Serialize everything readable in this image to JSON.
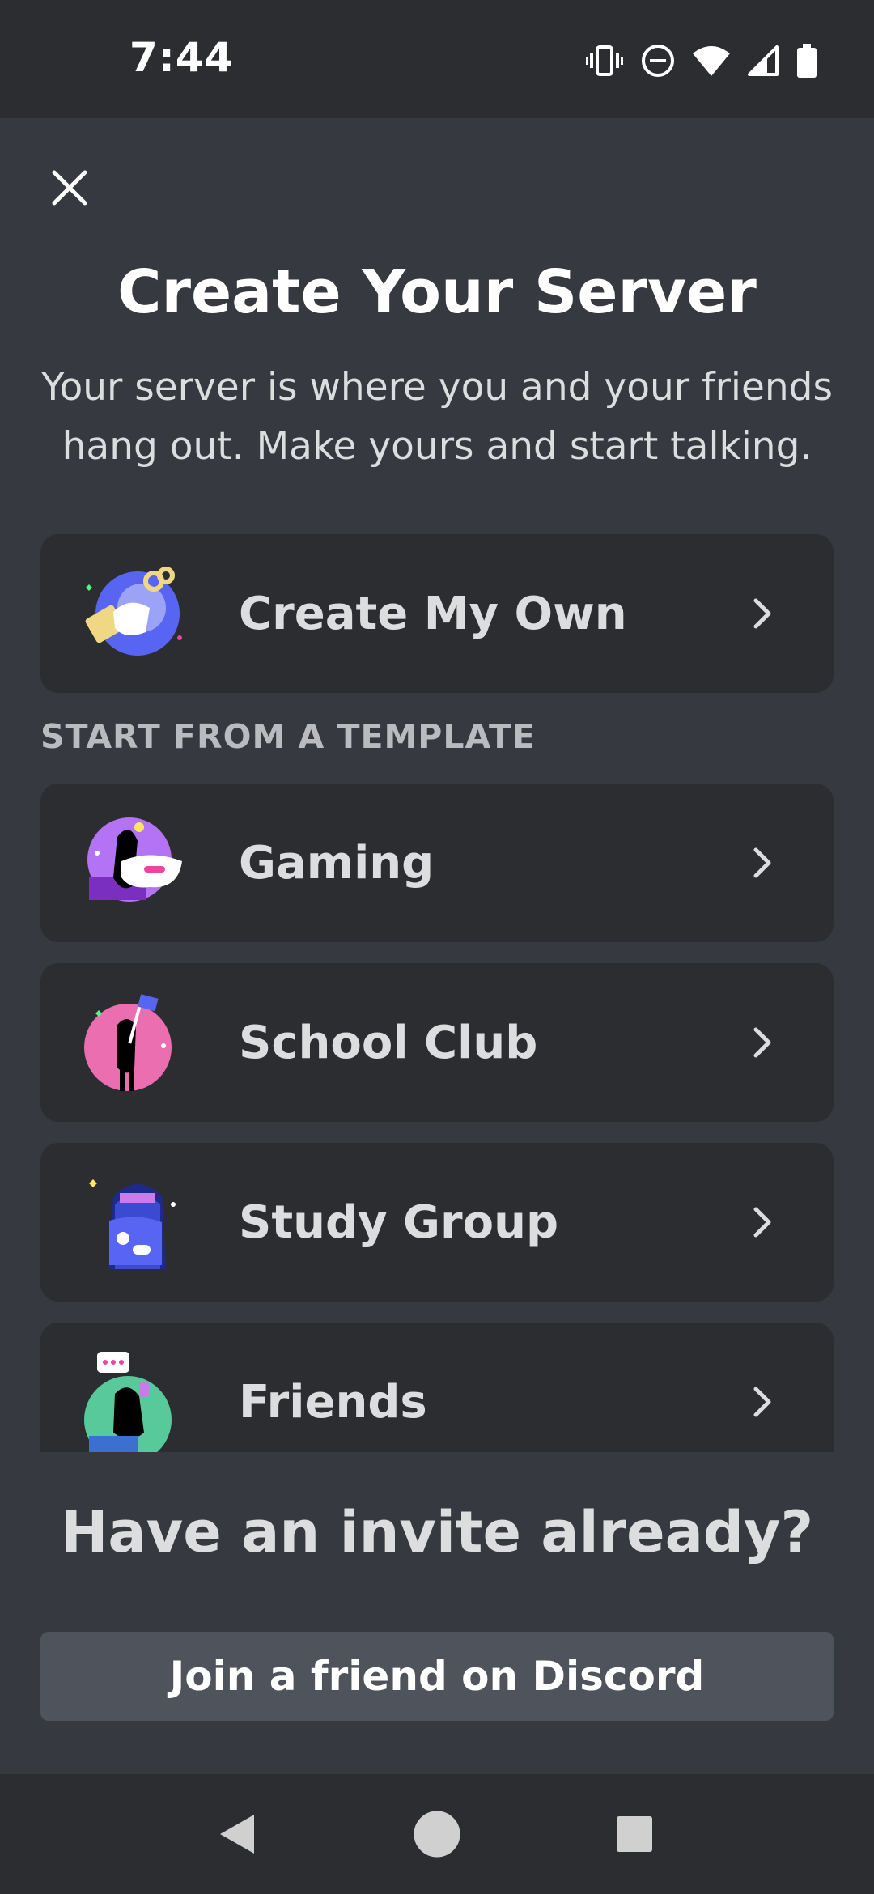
{
  "status_bar": {
    "time": "7:44",
    "icons": [
      "vibrate-icon",
      "do-not-disturb-icon",
      "wifi-icon",
      "cellular-signal-icon",
      "battery-icon"
    ]
  },
  "header": {
    "close_icon": "close-icon",
    "title": "Create Your Server",
    "subtitle_line1": "Your server is where you and your friends",
    "subtitle_line2": "hang out. Make yours and start talking."
  },
  "create_own": {
    "label": "Create My Own",
    "icon": "create-server-illustration-icon",
    "chevron": "chevron-right-icon"
  },
  "templates": {
    "section_label": "START FROM A TEMPLATE",
    "items": [
      {
        "label": "Gaming",
        "icon": "gaming-illustration-icon"
      },
      {
        "label": "School Club",
        "icon": "school-club-illustration-icon"
      },
      {
        "label": "Study Group",
        "icon": "study-group-illustration-icon"
      },
      {
        "label": "Friends",
        "icon": "friends-illustration-icon"
      }
    ]
  },
  "invite": {
    "heading": "Have an invite already?",
    "button_label": "Join a friend on Discord"
  },
  "nav_bar": {
    "icons": [
      "back-icon",
      "home-icon",
      "recents-icon"
    ]
  },
  "colors": {
    "background": "#36393f",
    "card": "#2b2d31",
    "button": "#4f545c",
    "text_primary": "#ffffff",
    "text_secondary": "#dcddde",
    "section_label": "#b9bbbe"
  }
}
